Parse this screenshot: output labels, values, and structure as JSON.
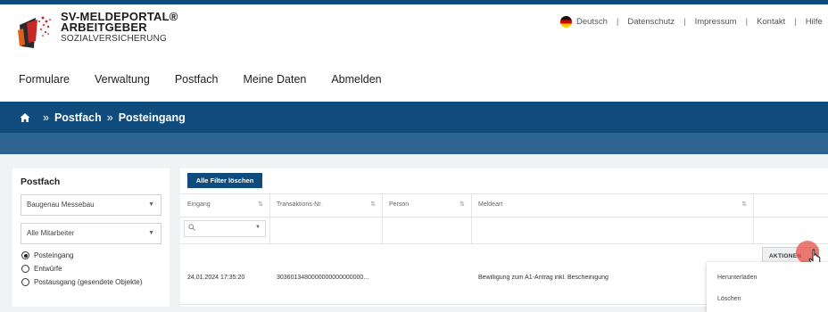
{
  "brand": {
    "line1": "SV-MELDEPORTAL®",
    "line2": "ARBEITGEBER",
    "line3": "SOZIALVERSICHERUNG"
  },
  "toplinks": [
    "Deutsch",
    "Datenschutz",
    "Impressum",
    "Kontakt",
    "Hilfe"
  ],
  "mainnav": [
    "Formulare",
    "Verwaltung",
    "Postfach",
    "Meine Daten",
    "Abmelden"
  ],
  "breadcrumb": {
    "items": [
      "Postfach",
      "Posteingang"
    ],
    "separator": "»"
  },
  "sidebar": {
    "title": "Postfach",
    "company_select": "Baugenau Messebau",
    "employee_select": "Alle Mitarbeiter",
    "radios": [
      {
        "label": "Posteingang",
        "checked": true
      },
      {
        "label": "Entwürfe",
        "checked": false
      },
      {
        "label": "Postausgang (gesendete Objekte)",
        "checked": false
      }
    ]
  },
  "table": {
    "clear_filters_label": "Alle Filter löschen",
    "columns": [
      "Eingang",
      "Transaktions-Nr.",
      "Person",
      "Meldeart"
    ],
    "rows": [
      {
        "eingang": "24.01.2024 17:35:20",
        "transaktion": "3036013480000000000000000...",
        "person": "",
        "meldeart": "Bewilligung zum A1-Antrag inkl. Bescheinigung"
      }
    ],
    "actions_label": "AKTIONEN",
    "dropdown": [
      "Herunterladen",
      "Löschen"
    ]
  },
  "colors": {
    "primary": "#0f4c7d",
    "band": "#2f6490",
    "click": "#e65046"
  }
}
